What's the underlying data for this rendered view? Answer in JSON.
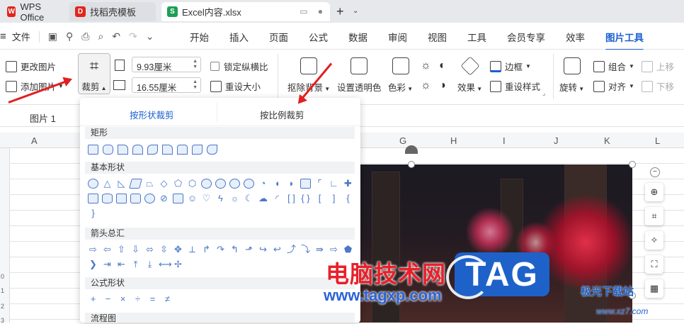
{
  "tabs": [
    {
      "label": "WPS Office",
      "icon": "wps-logo-icon",
      "color": "#e1251b"
    },
    {
      "label": "找稻壳模板",
      "icon": "docer-icon",
      "color": "#e1251b"
    },
    {
      "label": "Excel内容.xlsx",
      "icon": "spreadsheet-icon",
      "icon_text": "S",
      "color": "#1e9f55"
    }
  ],
  "menubar": {
    "file_label": "文件",
    "items": [
      "开始",
      "插入",
      "页面",
      "公式",
      "数据",
      "审阅",
      "视图",
      "工具",
      "会员专享",
      "效率",
      "图片工具"
    ],
    "active": "图片工具"
  },
  "ribbon": {
    "change_picture": "更改图片",
    "add_picture": "添加图片",
    "crop": "裁剪",
    "height_value": "9.93厘米",
    "width_value": "16.55厘米",
    "lock_aspect": "锁定纵横比",
    "reset_size": "重设大小",
    "remove_bg": "抠除背景",
    "set_transparent": "设置透明色",
    "color": "色彩",
    "effects": "效果",
    "border": "边框",
    "reset_style": "重设样式",
    "rotate": "旋转",
    "group": "组合",
    "align": "对齐",
    "bring_forward": "上移",
    "send_backward": "下移"
  },
  "namebox": "图片 1",
  "columns": [
    "A",
    "G",
    "H",
    "I",
    "J",
    "K",
    "L"
  ],
  "rows": [
    "0",
    "1",
    "2",
    "3"
  ],
  "crop_menu": {
    "tab_shape": "按形状裁剪",
    "tab_ratio": "按比例裁剪",
    "sections": [
      "矩形",
      "基本形状",
      "箭头总汇",
      "公式形状",
      "流程图"
    ],
    "eq_symbols": [
      "+",
      "−",
      "×",
      "÷",
      "=",
      "≠"
    ]
  },
  "watermark": {
    "cn": "电脑技术网",
    "url": "www.tagxp.com",
    "tag": "TAG",
    "aurora": "极光下载站",
    "aurora_url": "www.xz7.com"
  },
  "colors": {
    "accent": "#1a5fd1",
    "arrow": "#e02020"
  }
}
